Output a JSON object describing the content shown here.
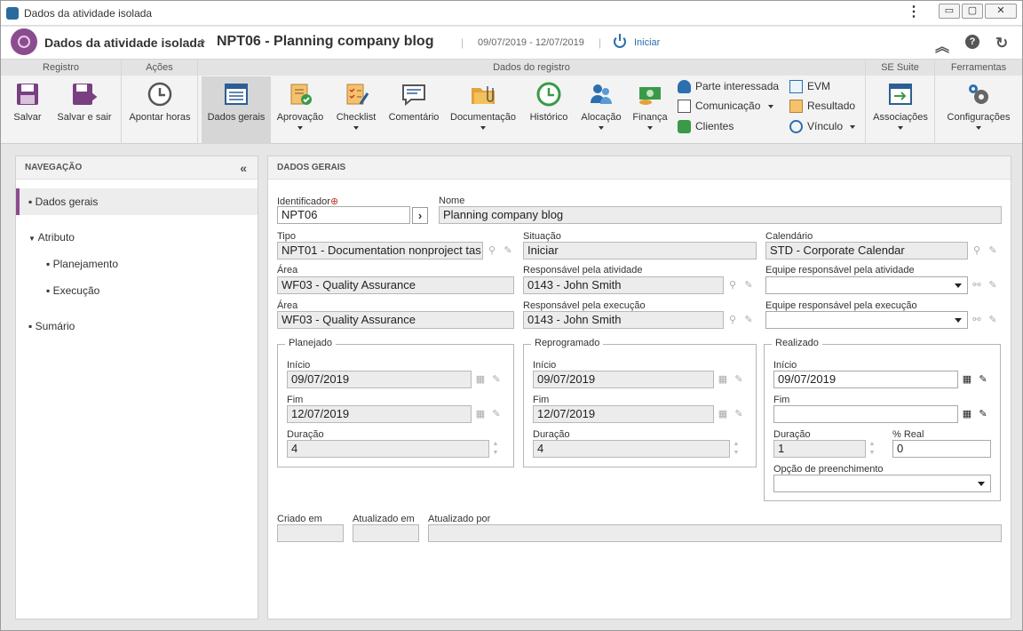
{
  "window": {
    "title": "Dados da atividade isolada"
  },
  "header": {
    "title": "Dados da atividade isolada",
    "record": "NPT06 - Planning company blog",
    "dates": "09/07/2019 - 12/07/2019",
    "status": "Iniciar"
  },
  "ribbon": {
    "groups": {
      "registro": "Registro",
      "acoes": "Ações",
      "dados": "Dados do registro",
      "suite": "SE Suite",
      "ferramentas": "Ferramentas"
    },
    "buttons": {
      "salvar": "Salvar",
      "salvar_sair": "Salvar e sair",
      "apontar": "Apontar horas",
      "dados_gerais": "Dados gerais",
      "aprovacao": "Aprovação",
      "checklist": "Checklist",
      "comentario": "Comentário",
      "documentacao": "Documentação",
      "historico": "Histórico",
      "alocacao": "Alocação",
      "financa": "Finança",
      "parte": "Parte interessada",
      "comunicacao": "Comunicação",
      "clientes": "Clientes",
      "evm": "EVM",
      "resultado": "Resultado",
      "vinculo": "Vínculo",
      "associacoes": "Associações",
      "configuracoes": "Configurações"
    }
  },
  "nav": {
    "title": "NAVEGAÇÃO",
    "items": [
      "Dados gerais",
      "Atributo",
      "Planejamento",
      "Execução",
      "Sumário"
    ]
  },
  "main": {
    "title": "DADOS GERAIS",
    "identificador_label": "Identificador",
    "identificador": "NPT06",
    "nome_label": "Nome",
    "nome": "Planning company blog",
    "tipo_label": "Tipo",
    "tipo": "NPT01 - Documentation nonproject tas",
    "situacao_label": "Situação",
    "situacao": "Iniciar",
    "calendario_label": "Calendário",
    "calendario": "STD - Corporate Calendar",
    "area_label": "Área",
    "area": "WF03 - Quality Assurance",
    "resp_ativ_label": "Responsável pela atividade",
    "resp_ativ": "0143 - John Smith",
    "equipe_ativ_label": "Equipe responsável pela atividade",
    "area2_label": "Área",
    "area2": "WF03 - Quality Assurance",
    "resp_exec_label": "Responsável pela execução",
    "resp_exec": "0143 - John Smith",
    "equipe_exec_label": "Equipe responsável pela execução",
    "planejado": {
      "legend": "Planejado",
      "inicio_label": "Início",
      "inicio": "09/07/2019",
      "fim_label": "Fim",
      "fim": "12/07/2019",
      "duracao_label": "Duração",
      "duracao": "4"
    },
    "reprogramado": {
      "legend": "Reprogramado",
      "inicio_label": "Início",
      "inicio": "09/07/2019",
      "fim_label": "Fim",
      "fim": "12/07/2019",
      "duracao_label": "Duração",
      "duracao": "4"
    },
    "realizado": {
      "legend": "Realizado",
      "inicio_label": "Início",
      "inicio": "09/07/2019",
      "fim_label": "Fim",
      "fim": "",
      "duracao_label": "Duração",
      "duracao": "1",
      "real_label": "% Real",
      "real": "0",
      "opcao_label": "Opção de preenchimento"
    },
    "criado_label": "Criado em",
    "atualizado_label": "Atualizado em",
    "atualizado_por_label": "Atualizado por"
  }
}
